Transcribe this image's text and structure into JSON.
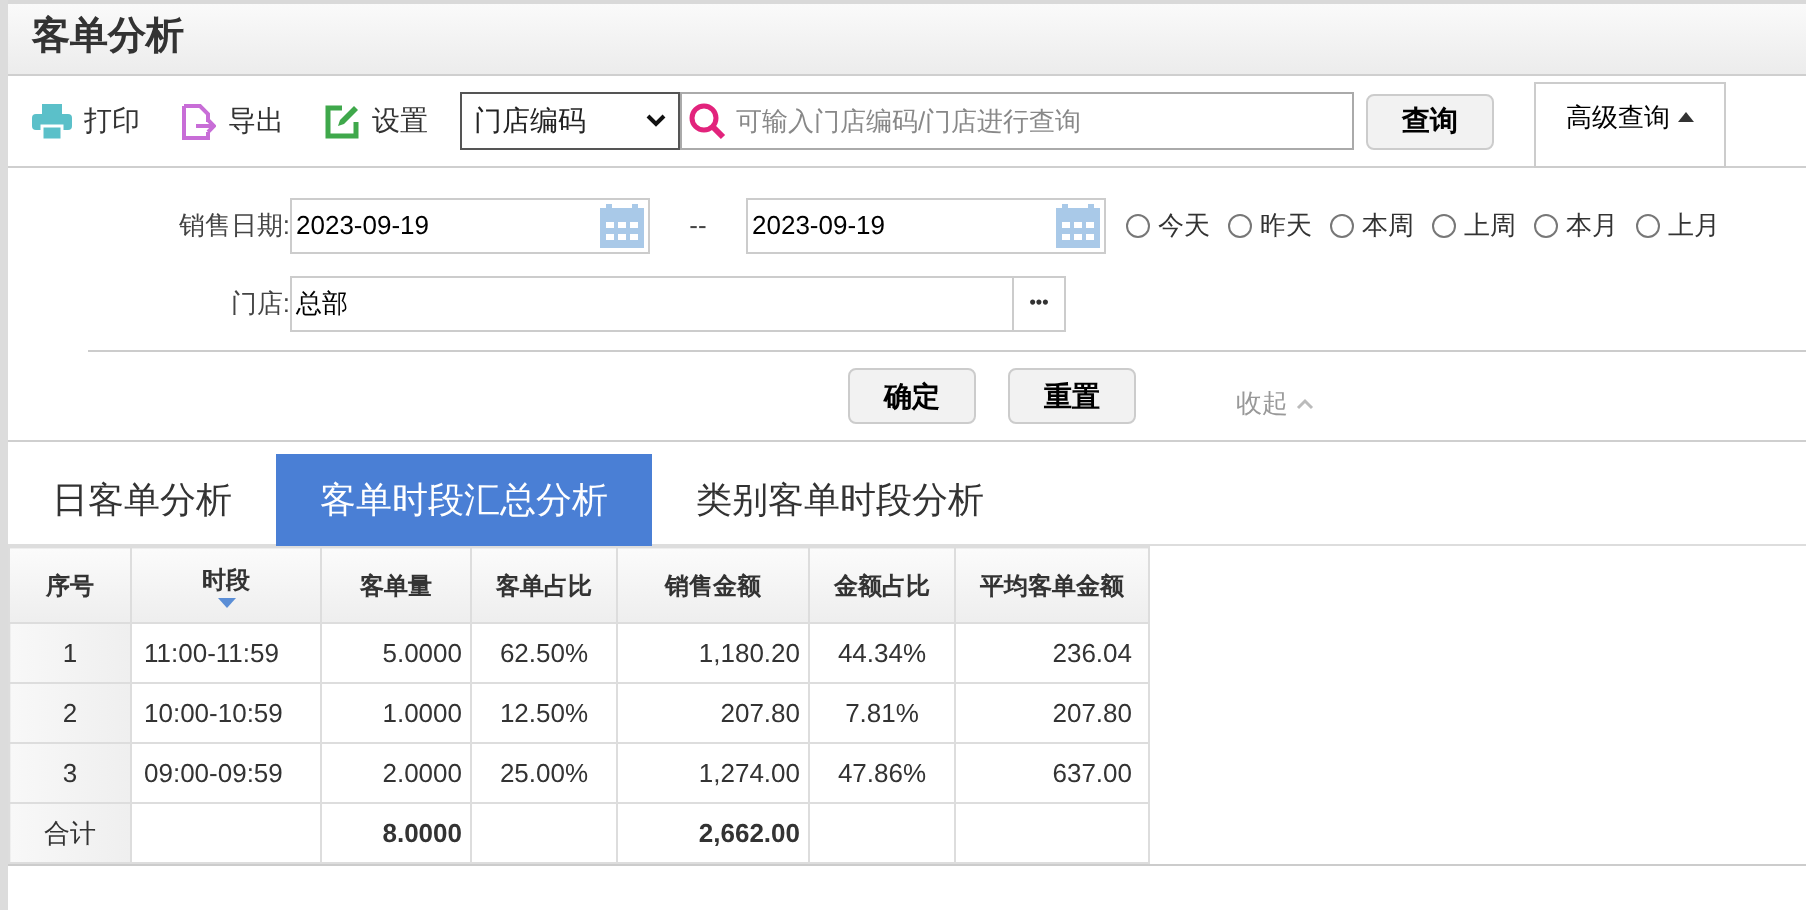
{
  "title": "客单分析",
  "toolbar": {
    "actions": [
      {
        "kind": "print",
        "label": "打印"
      },
      {
        "kind": "export",
        "label": "导出"
      },
      {
        "kind": "settings",
        "label": "设置"
      }
    ],
    "search_type": "门店编码",
    "search": {
      "placeholder": "可输入门店编码/门店进行查询"
    },
    "search_button": "查询",
    "advanced": {
      "label": "高级查询",
      "expanded": true
    }
  },
  "filters": {
    "date_label": "销售日期:",
    "date_from": "2023-09-19",
    "separator": "--",
    "date_to": "2023-09-19",
    "quick_ranges": [
      {
        "label": "今天",
        "selected": false
      },
      {
        "label": "昨天",
        "selected": false
      },
      {
        "label": "本周",
        "selected": false
      },
      {
        "label": "上周",
        "selected": false
      },
      {
        "label": "本月",
        "selected": false
      },
      {
        "label": "上月",
        "selected": false
      }
    ],
    "store_label": "门店:",
    "store": "总部",
    "browse_button": "•••",
    "confirm": "确定",
    "reset": "重置",
    "collapse": "收起"
  },
  "tabs": [
    {
      "label": "日客单分析",
      "selected": false
    },
    {
      "label": "客单时段汇总分析",
      "selected": true
    },
    {
      "label": "类别客单时段分析",
      "selected": false
    }
  ],
  "table": {
    "columns": [
      {
        "label": "序号",
        "sorted": false
      },
      {
        "label": "时段",
        "sorted": true
      },
      {
        "label": "客单量",
        "sorted": false
      },
      {
        "label": "客单占比",
        "sorted": false
      },
      {
        "label": "销售金额",
        "sorted": false
      },
      {
        "label": "金额占比",
        "sorted": false
      },
      {
        "label": "平均客单金额",
        "sorted": false
      }
    ],
    "rows": [
      [
        "1",
        "11:00-11:59",
        "5.0000",
        "62.50%",
        "1,180.20",
        "44.34%",
        "236.04"
      ],
      [
        "2",
        "10:00-10:59",
        "1.0000",
        "12.50%",
        "207.80",
        "7.81%",
        "207.80"
      ],
      [
        "3",
        "09:00-09:59",
        "2.0000",
        "25.00%",
        "1,274.00",
        "47.86%",
        "637.00"
      ]
    ],
    "totals": {
      "label": "合计",
      "customer_count": "8.0000",
      "sales_amount": "2,662.00"
    }
  }
}
